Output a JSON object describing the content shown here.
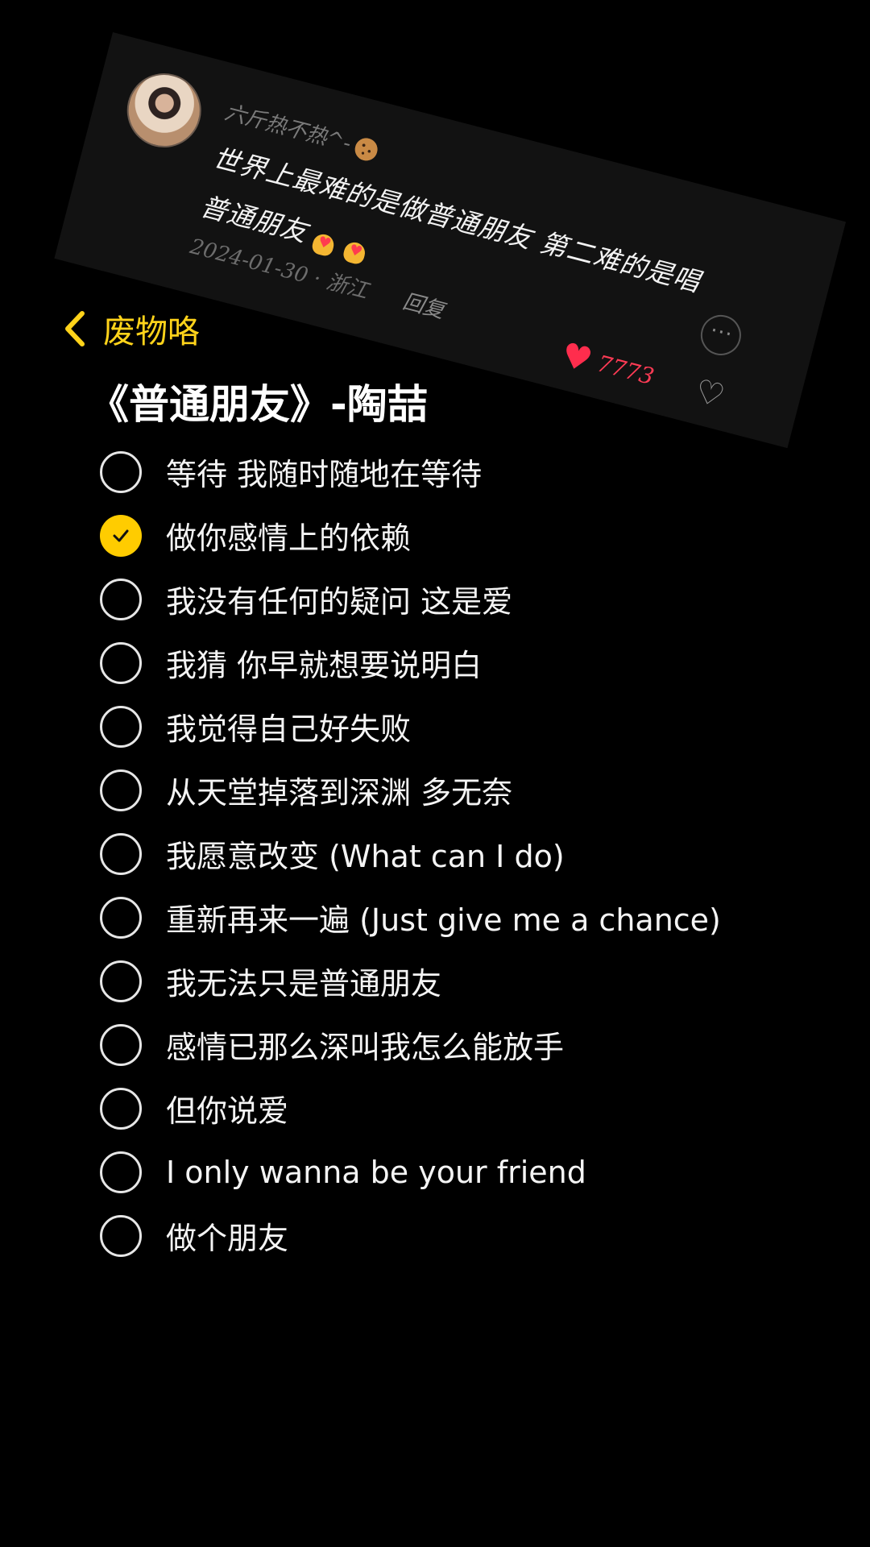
{
  "comment": {
    "username": "六斤热不热^-",
    "text_line1": "世界上最难的是做普通朋友 第二难的是唱",
    "text_line2": "普通朋友",
    "date": "2024-01-30 · 浙江",
    "reply_label": "回复",
    "like_count": "7773",
    "username_icon": "cookie-icon",
    "reaction_icons": [
      "heart-hand-icon",
      "heart-hand-icon"
    ]
  },
  "header": {
    "back_label": "废物咯",
    "title": "《普通朋友》-陶喆"
  },
  "colors": {
    "accent": "#ffd31a",
    "check_fill": "#ffcc00",
    "like": "#ff2d4d",
    "background": "#000000"
  },
  "lyrics": [
    {
      "text": "等待 我随时随地在等待",
      "checked": false
    },
    {
      "text": "做你感情上的依赖",
      "checked": true
    },
    {
      "text": "我没有任何的疑问 这是爱",
      "checked": false
    },
    {
      "text": "我猜 你早就想要说明白",
      "checked": false
    },
    {
      "text": "我觉得自己好失败",
      "checked": false
    },
    {
      "text": "从天堂掉落到深渊 多无奈",
      "checked": false
    },
    {
      "text": "我愿意改变 (What can I do)",
      "checked": false
    },
    {
      "text": "重新再来一遍 (Just give me a chance)",
      "checked": false
    },
    {
      "text": "我无法只是普通朋友",
      "checked": false
    },
    {
      "text": "感情已那么深叫我怎么能放手",
      "checked": false
    },
    {
      "text": "但你说爱",
      "checked": false
    },
    {
      "text": "I only wanna be your friend",
      "checked": false
    },
    {
      "text": "做个朋友",
      "checked": false
    }
  ]
}
